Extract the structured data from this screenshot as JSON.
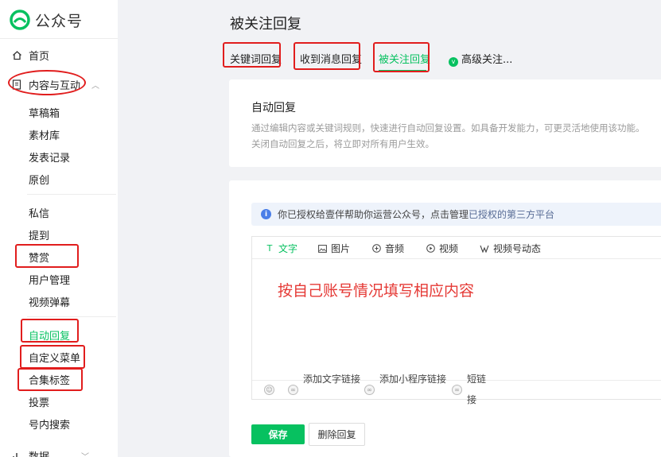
{
  "app": {
    "logo_text": "公众号"
  },
  "sidebar": {
    "top": [
      {
        "label": "首页"
      },
      {
        "label": "内容与互动"
      }
    ],
    "group1": [
      "草稿箱",
      "素材库",
      "发表记录",
      "原创"
    ],
    "group2": [
      "私信",
      "提到",
      "赞赏",
      "用户管理",
      "视频弹幕"
    ],
    "group3": [
      "自动回复",
      "自定义菜单",
      "合集标签",
      "投票",
      "号内搜索"
    ],
    "bottom": {
      "label": "数据"
    }
  },
  "page": {
    "title": "被关注回复"
  },
  "tabs": [
    {
      "label": "关键词回复"
    },
    {
      "label": "收到消息回复"
    },
    {
      "label": "被关注回复"
    },
    {
      "label": "高级关注..."
    }
  ],
  "intro": {
    "title": "自动回复",
    "desc_line1": "通过编辑内容或关键词规则，快速进行自动回复设置。如具备开发能力，可更灵活地使用该功能。",
    "desc_line2": "关闭自动回复之后，将立即对所有用户生效。"
  },
  "notice": {
    "text": "你已授权给壹伴帮助你运营公众号，点击管理",
    "link": "已授权的第三方平台"
  },
  "editor": {
    "tabs": [
      {
        "icon": "text-icon",
        "label": "文字"
      },
      {
        "icon": "image-icon",
        "label": "图片"
      },
      {
        "icon": "audio-icon",
        "label": "音频"
      },
      {
        "icon": "video-icon",
        "label": "视频"
      },
      {
        "icon": "channels-icon",
        "label": "视频号动态"
      }
    ],
    "content": "按自己账号情况填写相应内容",
    "footer": [
      {
        "label": "添加文字链接"
      },
      {
        "label": "添加小程序链接"
      },
      {
        "label": "短链接"
      }
    ]
  },
  "actions": {
    "save": "保存",
    "delete": "删除回复"
  },
  "colors": {
    "accent": "#07c160",
    "annotation": "#e11d1d",
    "link": "#576b95"
  }
}
